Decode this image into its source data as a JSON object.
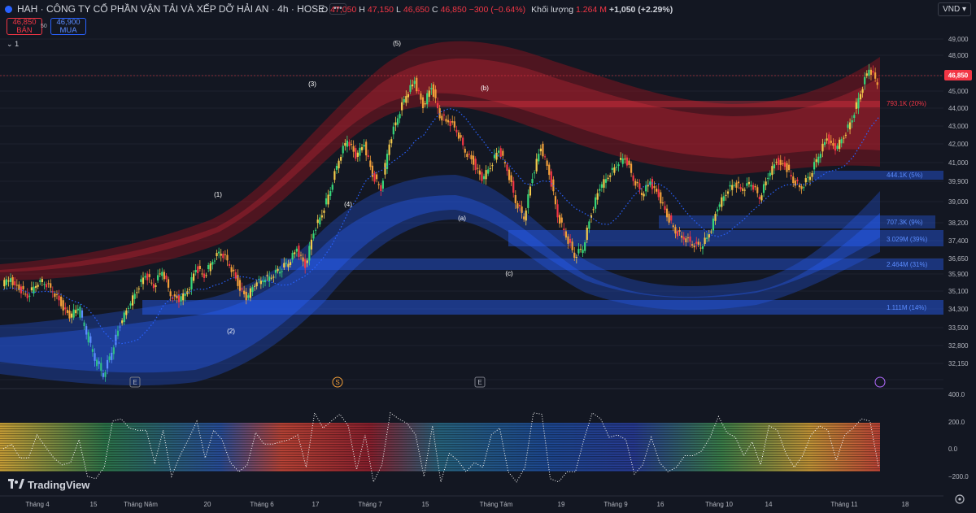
{
  "header": {
    "symbol_title": "HAH · CÔNG TY CỔ PHẦN VẬN TẢI VÀ XẾP DỠ HẢI AN · 4h · HOSE",
    "more_label": "•••",
    "ohlc": [
      {
        "k": "O",
        "v": "47,050"
      },
      {
        "k": "H",
        "v": "47,150"
      },
      {
        "k": "L",
        "v": "46,650"
      },
      {
        "k": "C",
        "v": "46,850"
      }
    ],
    "change": "−300 (−0.64%)",
    "volume_label": "Khối lượng",
    "volume_value": "1.264 M",
    "volume_change": "+1,050 (+2.29%)"
  },
  "trade": {
    "sell_price": "46,850",
    "sell_label": "BÁN",
    "spread": "50",
    "buy_price": "46,900",
    "buy_label": "MUA"
  },
  "collapse_label": "1",
  "currency": "VND",
  "brand": "TradingView",
  "colors": {
    "up": "#2ebd85",
    "down": "#f23645",
    "last_price_bg": "#f23645",
    "accent": "#2962ff"
  },
  "chart_data": {
    "type": "candlestick",
    "price_axis": [
      "49,000",
      "48,000",
      "46,850",
      "45,000",
      "44,000",
      "43,000",
      "42,000",
      "41,000",
      "39,900",
      "39,000",
      "38,200",
      "37,400",
      "36,650",
      "35,900",
      "35,100",
      "34,300",
      "33,500",
      "32,800",
      "32,150"
    ],
    "last_price": "46,850",
    "ylim": [
      31800,
      49500
    ],
    "time_axis": [
      "Tháng 4",
      "15",
      "Tháng Năm",
      "20",
      "Tháng 6",
      "17",
      "Tháng 7",
      "15",
      "Tháng Tám",
      "19",
      "Tháng 9",
      "16",
      "Tháng 10",
      "14",
      "Tháng 11",
      "18"
    ],
    "volume_profile_labels": [
      "793.1K (20%)",
      "444.1K (5%)",
      "707.3K (9%)",
      "3.029M (39%)",
      "2.464M (31%)",
      "1.111M (14%)"
    ],
    "wave_labels": [
      "(1)",
      "(2)",
      "(3)",
      "(4)",
      "(5)",
      "(a)",
      "(b)",
      "(c)"
    ],
    "event_markers": [
      "E",
      "S",
      "E"
    ],
    "oscillator_axis": [
      "400.0",
      "200.0",
      "0.0",
      "−200.0"
    ],
    "close_path": [
      36900,
      37100,
      36700,
      36300,
      36900,
      37000,
      36600,
      35900,
      35300,
      35700,
      34500,
      33200,
      32400,
      33600,
      34900,
      35800,
      36600,
      37400,
      36800,
      37600,
      36400,
      36100,
      36500,
      37700,
      37300,
      38100,
      38500,
      37900,
      36900,
      36200,
      36900,
      37100,
      37300,
      37600,
      38000,
      38600,
      37800,
      39500,
      40400,
      41600,
      43100,
      44100,
      43200,
      43800,
      42300,
      41600,
      43900,
      45200,
      46300,
      46900,
      45700,
      46700,
      45200,
      45000,
      44500,
      43500,
      42900,
      42100,
      42700,
      43600,
      42600,
      41000,
      40200,
      42200,
      43700,
      42400,
      40300,
      39300,
      38300,
      38700,
      40400,
      41700,
      42200,
      42800,
      43200,
      42100,
      41400,
      41900,
      41300,
      40300,
      39500,
      39200,
      38900,
      38800,
      39300,
      40700,
      41400,
      41900,
      41600,
      41900,
      41200,
      42200,
      43000,
      42800,
      42000,
      41700,
      42300,
      43300,
      44100,
      43600,
      44200,
      45100,
      46400,
      47600,
      46850
    ]
  }
}
